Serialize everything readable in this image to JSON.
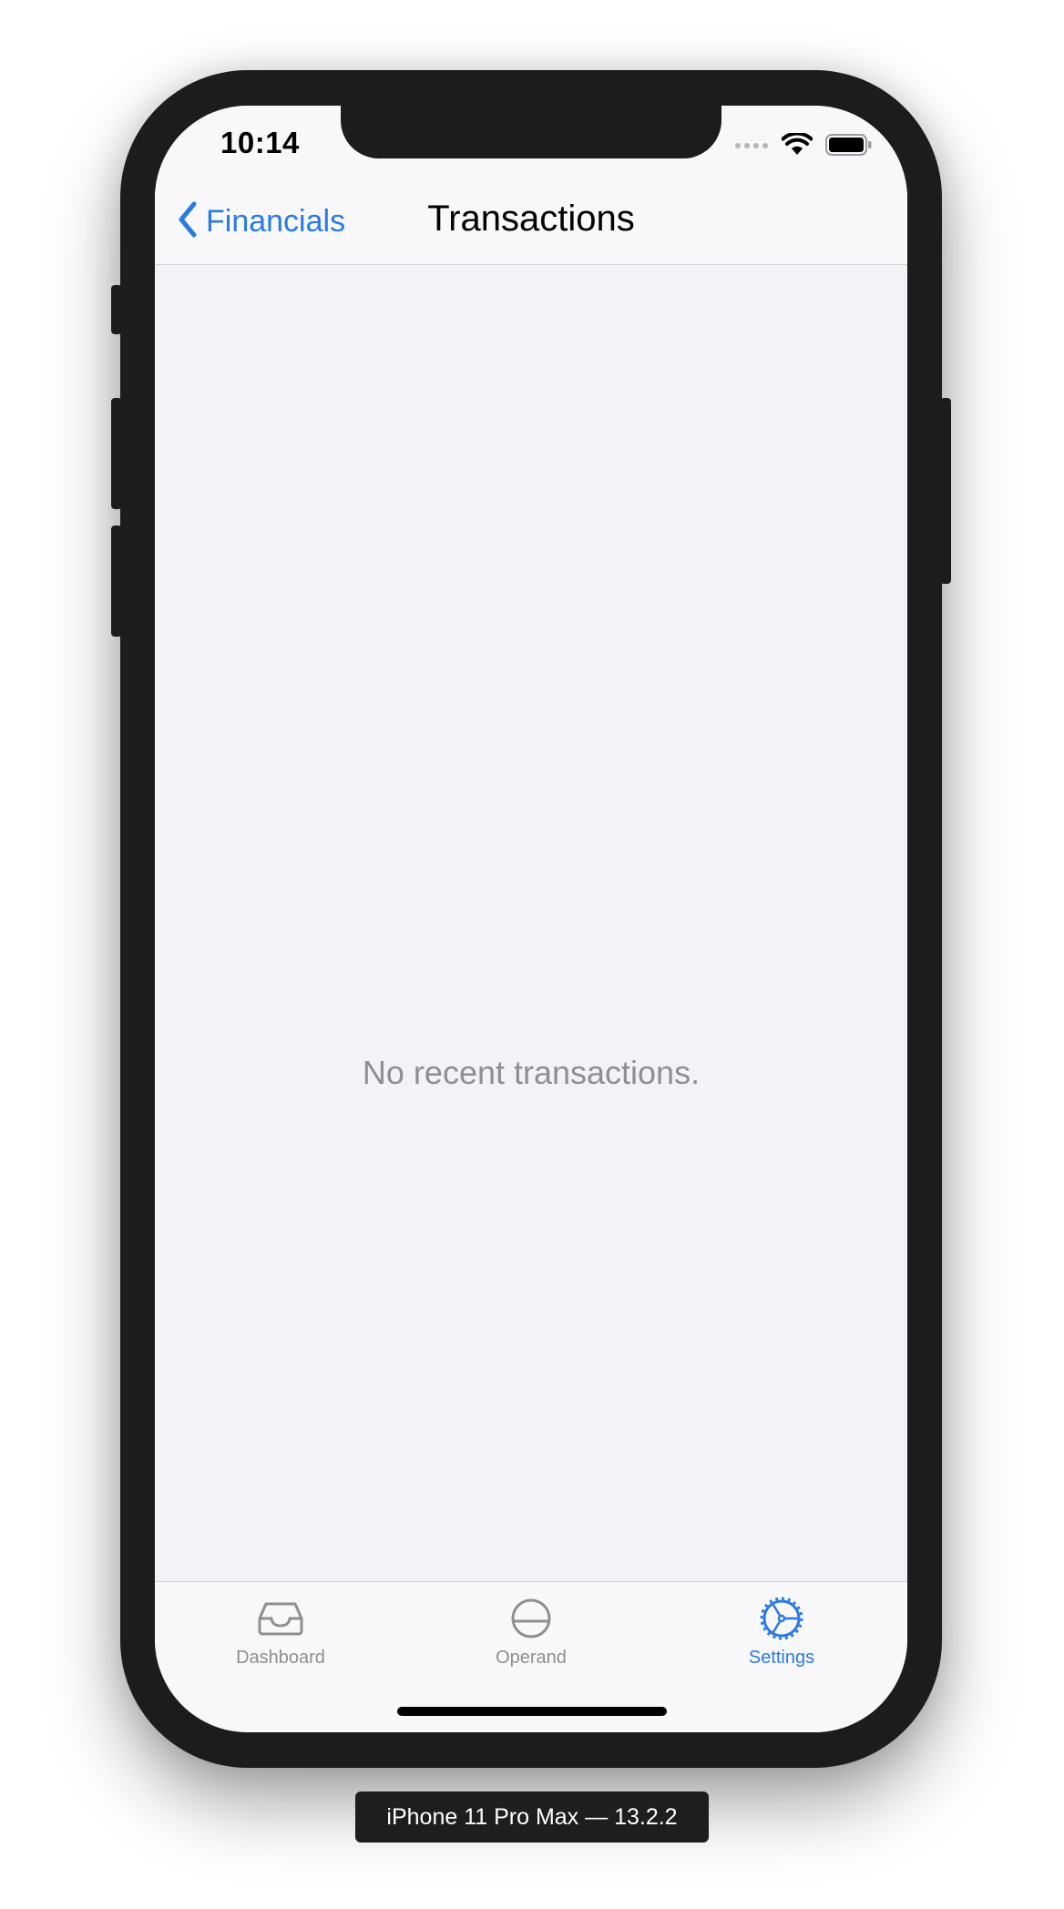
{
  "status_bar": {
    "time": "10:14"
  },
  "nav_bar": {
    "back_label": "Financials",
    "title": "Transactions"
  },
  "content": {
    "empty_message": "No recent transactions."
  },
  "tab_bar": {
    "tabs": [
      {
        "label": "Dashboard",
        "icon": "tray-icon",
        "active": false
      },
      {
        "label": "Operand",
        "icon": "circle-half-icon",
        "active": false
      },
      {
        "label": "Settings",
        "icon": "gear-icon",
        "active": true
      }
    ]
  },
  "device_label": "iPhone 11 Pro Max — 13.2.2",
  "colors": {
    "accent": "#2a7ae2",
    "inactive": "#8e8e93",
    "background": "#f2f2f7"
  }
}
